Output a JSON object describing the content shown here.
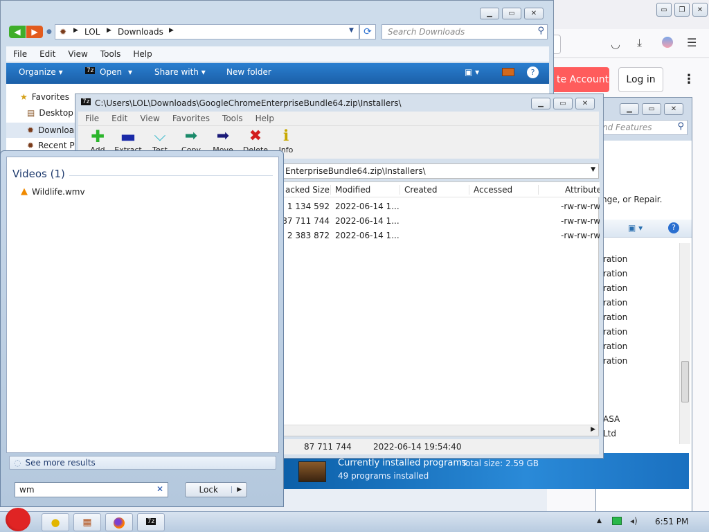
{
  "browser": {
    "create_account": "te Account",
    "login": "Log in"
  },
  "explorer": {
    "path": [
      "LOL",
      "Downloads"
    ],
    "search_placeholder": "Search Downloads",
    "menu": [
      "File",
      "Edit",
      "View",
      "Tools",
      "Help"
    ],
    "toolbar": {
      "organize": "Organize",
      "open": "Open",
      "share": "Share with",
      "new_folder": "New folder"
    },
    "nav": [
      "Favorites",
      "Desktop",
      "Downloa",
      "Recent Pl"
    ]
  },
  "sevenzip": {
    "title": "C:\\Users\\LOL\\Downloads\\GoogleChromeEnterpriseBundle64.zip\\Installers\\",
    "menu": [
      "File",
      "Edit",
      "View",
      "Favorites",
      "Tools",
      "Help"
    ],
    "tools": [
      "Add",
      "Extract",
      "Test",
      "Copy",
      "Move",
      "Delete",
      "Info"
    ],
    "address": "EnterpriseBundle64.zip\\Installers\\",
    "columns": [
      "acked Size",
      "Modified",
      "Created",
      "Accessed",
      "Attribute"
    ],
    "rows": [
      {
        "size": "1 134 592",
        "modified": "2022-06-14 1...",
        "attr": "-rw-rw-rw"
      },
      {
        "size": "87 711 744",
        "modified": "2022-06-14 1...",
        "attr": "-rw-rw-rw"
      },
      {
        "size": "2 383 872",
        "modified": "2022-06-14 1...",
        "attr": "-rw-rw-rw"
      }
    ],
    "status_size": "87 711 744",
    "status_date": "2022-06-14 19:54:40"
  },
  "programs": {
    "search_placeholder": "nd Features",
    "desc": "nge, or Repair.",
    "publishers": [
      "ration",
      "ration",
      "ration",
      "ration",
      "ration",
      "ration",
      "ration",
      "ration",
      "",
      "",
      "ASA",
      "Ltd"
    ],
    "footer_title": "Currently installed programs",
    "footer_total": "Total size: 2.59 GB",
    "footer_count": "49 programs installed"
  },
  "start": {
    "group_title": "Videos (1)",
    "result": "Wildlife.wmv",
    "see_more": "See more results",
    "search_value": "wm",
    "lock_label": "Lock"
  },
  "taskbar": {
    "clock": "6:51 PM"
  }
}
